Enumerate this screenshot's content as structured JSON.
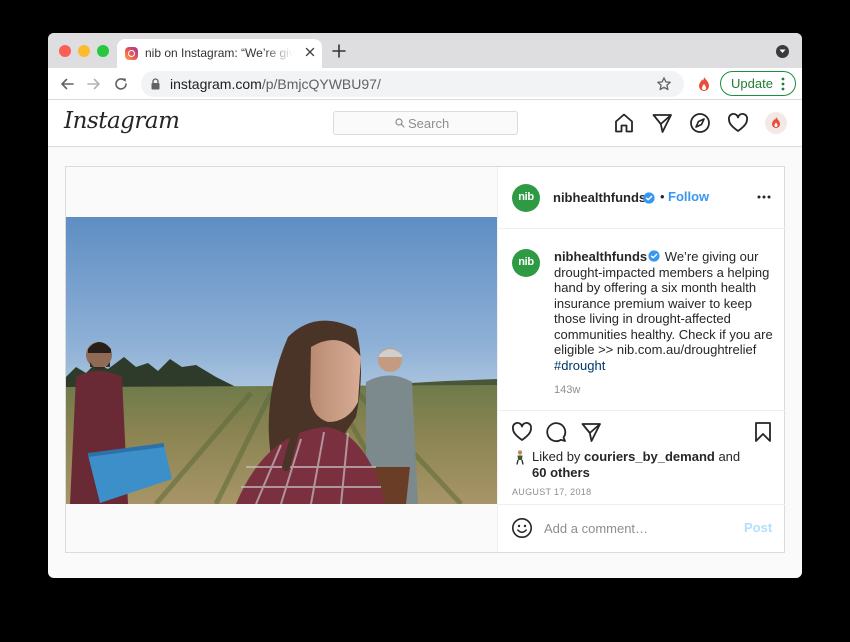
{
  "browser": {
    "tab_title": "nib on Instagram: “We’re giving our drought-impacted members",
    "url_host": "instagram.com",
    "url_path": "/p/BmjcQYWBU97/",
    "update_label": "Update"
  },
  "instagram": {
    "logo_text": "Instagram",
    "search_placeholder": "Search"
  },
  "post": {
    "account": {
      "username": "nibhealthfunds",
      "avatar_text": "nib",
      "separator": "•",
      "follow_label": "Follow",
      "brand_color": "#2e9a43"
    },
    "caption": {
      "username": "nibhealthfunds",
      "text": " We’re giving our drought-impacted members a helping hand by offering a six month health insurance premium waiver to keep those living in drought-affected communities healthy. Check if you are eligible >> nib.com.au/droughtrelief ",
      "hashtag": "#drought",
      "age": "143w"
    },
    "likes": {
      "prefix": "Liked by ",
      "liked_by_user": "couriers_by_demand",
      "connector": " and",
      "others": "60 others"
    },
    "date": "AUGUST 17, 2018",
    "comment": {
      "placeholder": "Add a comment…",
      "post_label": "Post"
    }
  },
  "colors": {
    "link_blue": "#3897f0",
    "update_green": "#1e8e3e"
  }
}
